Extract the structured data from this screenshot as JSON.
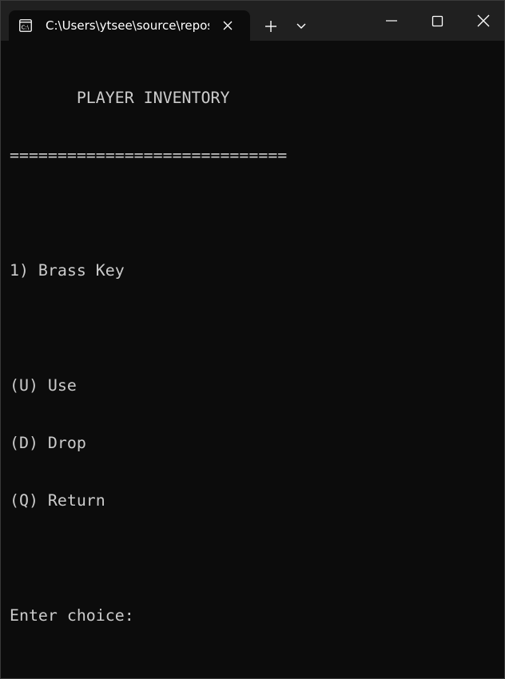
{
  "tab": {
    "title": "C:\\Users\\ytsee\\source\\repos\\",
    "icon": "terminal-icon"
  },
  "window_controls": {
    "new_tab_icon": "plus-icon",
    "dropdown_icon": "chevron-down-icon",
    "minimize_icon": "minimize-icon",
    "maximize_icon": "maximize-icon",
    "close_icon": "close-icon"
  },
  "console": {
    "heading": "       PLAYER INVENTORY",
    "separator": "=============================",
    "items": [
      "1) Brass Key"
    ],
    "options": [
      "(U) Use",
      "(D) Drop",
      "(Q) Return"
    ],
    "prompt": "Enter choice:"
  },
  "colors": {
    "background": "#0c0c0c",
    "titlebar": "#202020",
    "text": "#cccccc"
  }
}
